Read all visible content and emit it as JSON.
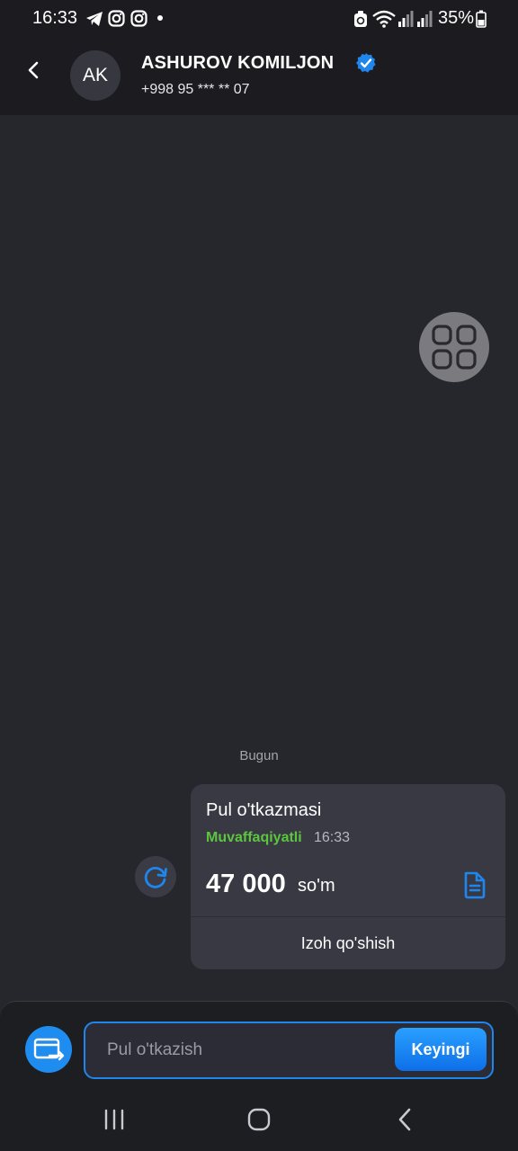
{
  "status_bar": {
    "time": "16:33",
    "battery_text": "35%",
    "icons": [
      "telegram-icon",
      "instagram-icon",
      "instagram-icon",
      "dot-icon",
      "alarm-icon",
      "wifi-icon",
      "signal-icon",
      "signal-icon",
      "battery-icon"
    ]
  },
  "header": {
    "avatar_initials": "AK",
    "name": "ASHUROV KOMILJON",
    "phone": "+998 95 *** ** 07",
    "verified_icon": "verified-badge-icon",
    "back_icon": "chevron-left-icon"
  },
  "chat": {
    "date_label": "Bugun",
    "message": {
      "title": "Pul o'tkazmasi",
      "status": "Muvaffaqiyatli",
      "time": "16:33",
      "amount": "47 000",
      "currency": "so'm",
      "add_note": "Izoh qo'shish"
    }
  },
  "composer": {
    "placeholder": "Pul o'tkazish",
    "value": "",
    "next_label": "Keyingi"
  },
  "colors": {
    "accent": "#1f86ee",
    "success": "#5cc63f",
    "background": "#26272d",
    "header_bg": "#1c1c20"
  }
}
